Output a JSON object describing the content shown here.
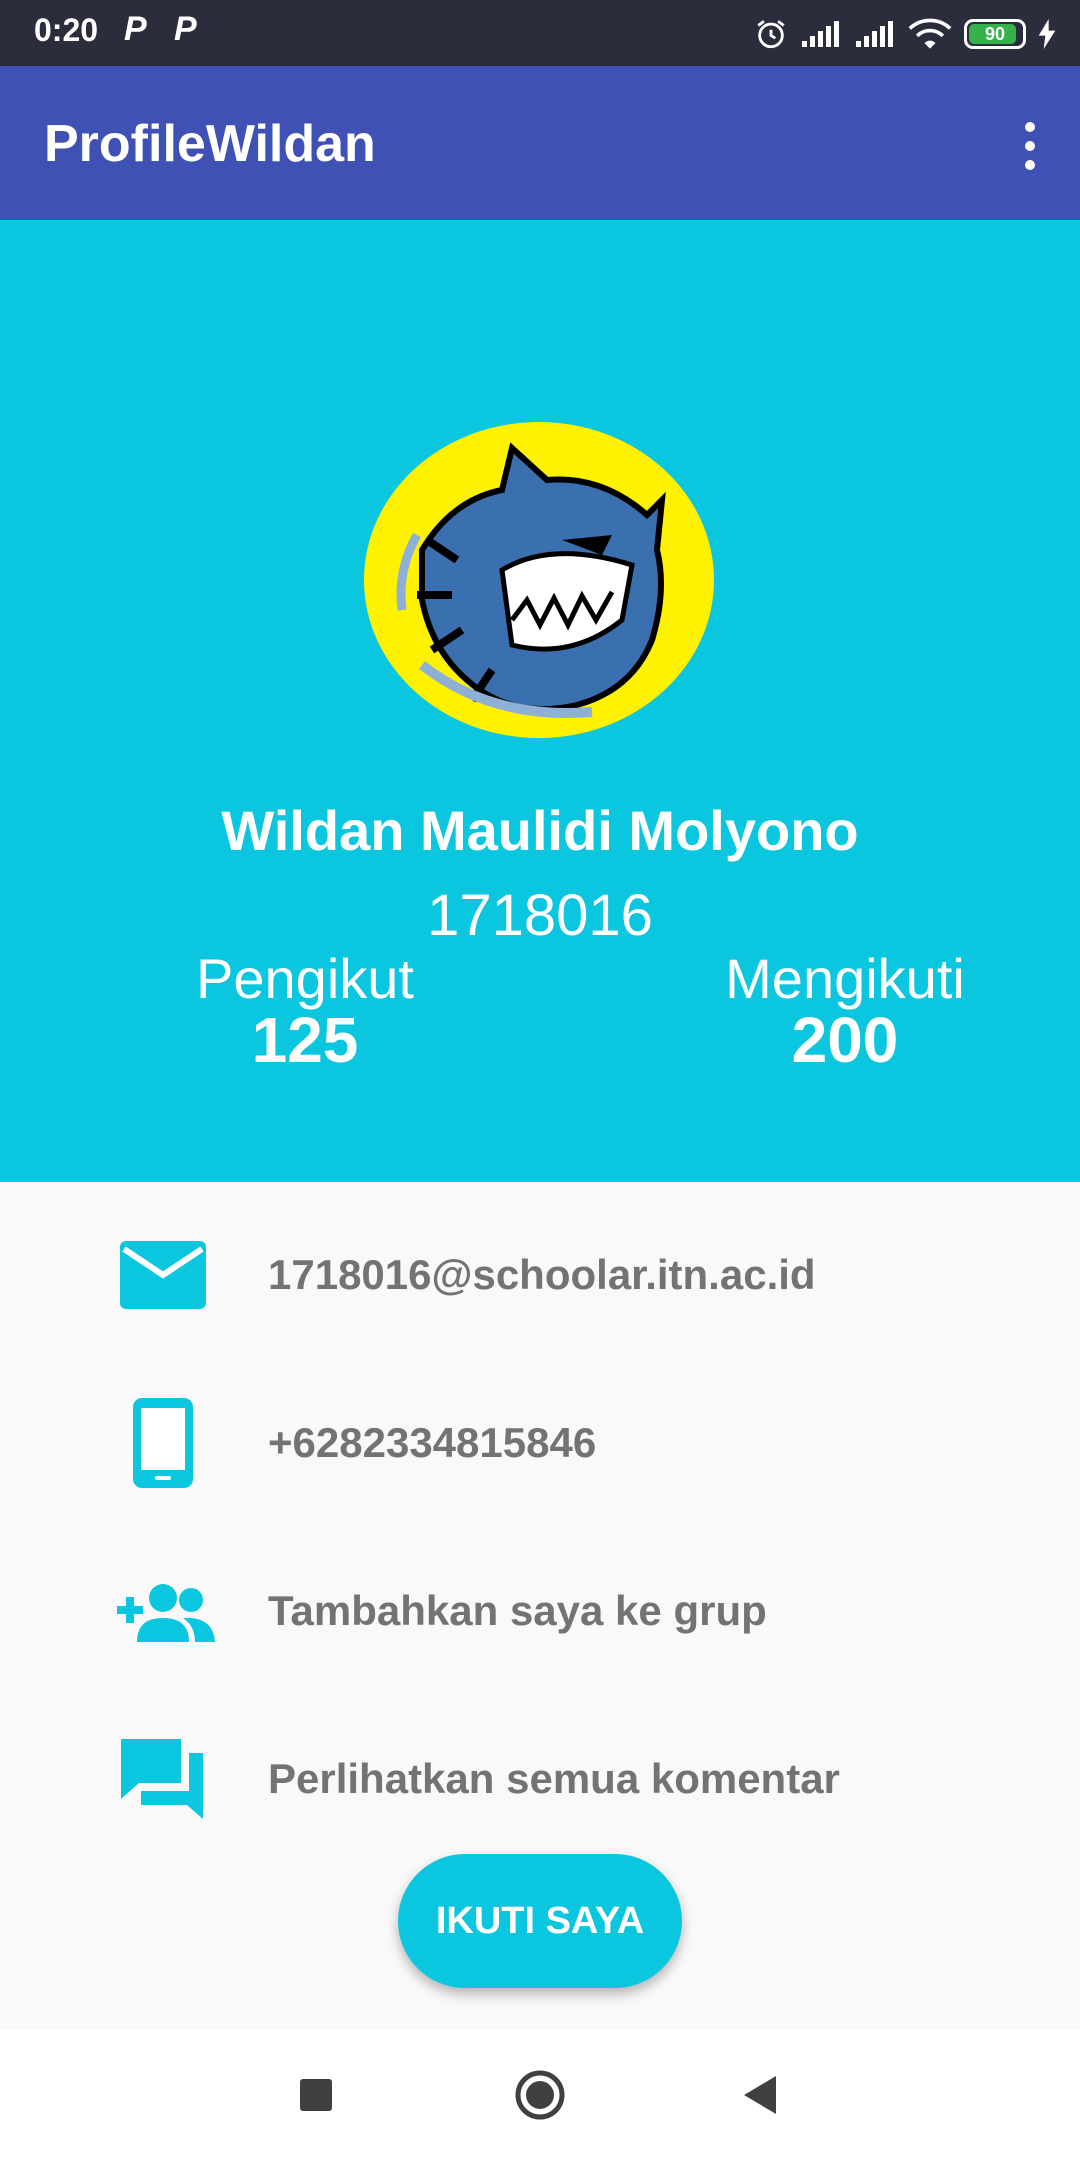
{
  "status_bar": {
    "time": "0:20",
    "notif_1": "P",
    "notif_2": "P",
    "battery_level": "90",
    "icons": [
      "alarm-icon",
      "signal-icon",
      "signal-icon",
      "wifi-icon",
      "battery-icon",
      "charging-icon"
    ]
  },
  "app_bar": {
    "title": "ProfileWildan",
    "menu_icon": "more-vert-icon"
  },
  "profile": {
    "avatar": "tiger-logo-avatar",
    "name": "Wildan Maulidi Molyono",
    "nim": "1718016",
    "followers_label": "Pengikut",
    "followers_count": "125",
    "following_label": "Mengikuti",
    "following_count": "200"
  },
  "contacts": [
    {
      "icon": "email-icon",
      "text": "1718016@schoolar.itn.ac.id"
    },
    {
      "icon": "phone-icon",
      "text": "+6282334815846"
    },
    {
      "icon": "group-add-icon",
      "text": "Tambahkan saya ke grup"
    },
    {
      "icon": "comments-icon",
      "text": "Perlihatkan semua komentar"
    }
  ],
  "follow_button": {
    "label": "IKUTI SAYA"
  },
  "nav_bar": {
    "buttons": [
      "recents-icon",
      "home-icon",
      "back-icon"
    ]
  },
  "colors": {
    "status_bar": "#2b2c3c",
    "app_bar": "#3f51b5",
    "accent": "#0bc6df",
    "text_gray": "#737373",
    "avatar_yellow": "#fff200",
    "tiger_blue": "#3a6fb0"
  }
}
